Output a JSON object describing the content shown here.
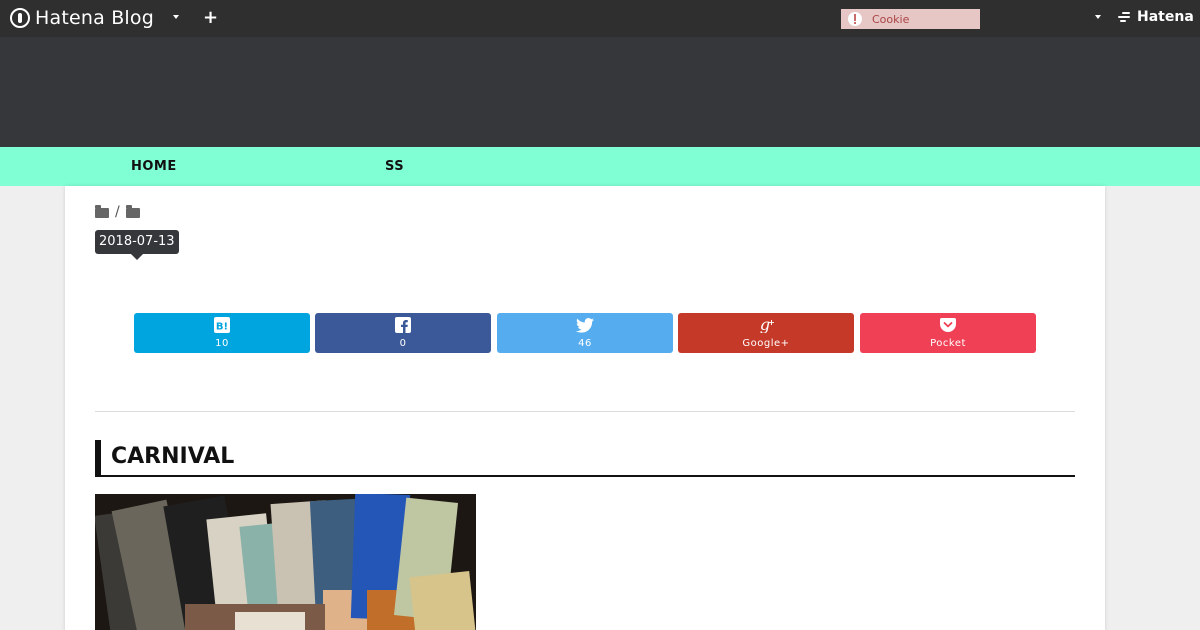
{
  "topbar": {
    "brand": "Hatena Blog",
    "brand_icon": "hatena-blog-icon",
    "add_icon": "plus-icon",
    "cookie_label": "Cookie",
    "cookie_icon": "alert-icon",
    "right_brand": "Hatena",
    "bg_color": "#2f2f2f"
  },
  "nav": {
    "items": [
      "HOME",
      "SS"
    ],
    "bg_color": "#80ffd4"
  },
  "entry": {
    "date": "2018-07-13",
    "title": "CARNIVAL"
  },
  "share": [
    {
      "service": "hatena-bookmark-icon",
      "label": "10",
      "color": "#00a4de"
    },
    {
      "service": "facebook-icon",
      "label": "0",
      "color": "#3b5998"
    },
    {
      "service": "twitter-icon",
      "label": "46",
      "color": "#55acee"
    },
    {
      "service": "google-plus-icon",
      "label": "Google+",
      "color": "#c53929"
    },
    {
      "service": "pocket-icon",
      "label": "Pocket",
      "color": "#ef4056"
    }
  ]
}
